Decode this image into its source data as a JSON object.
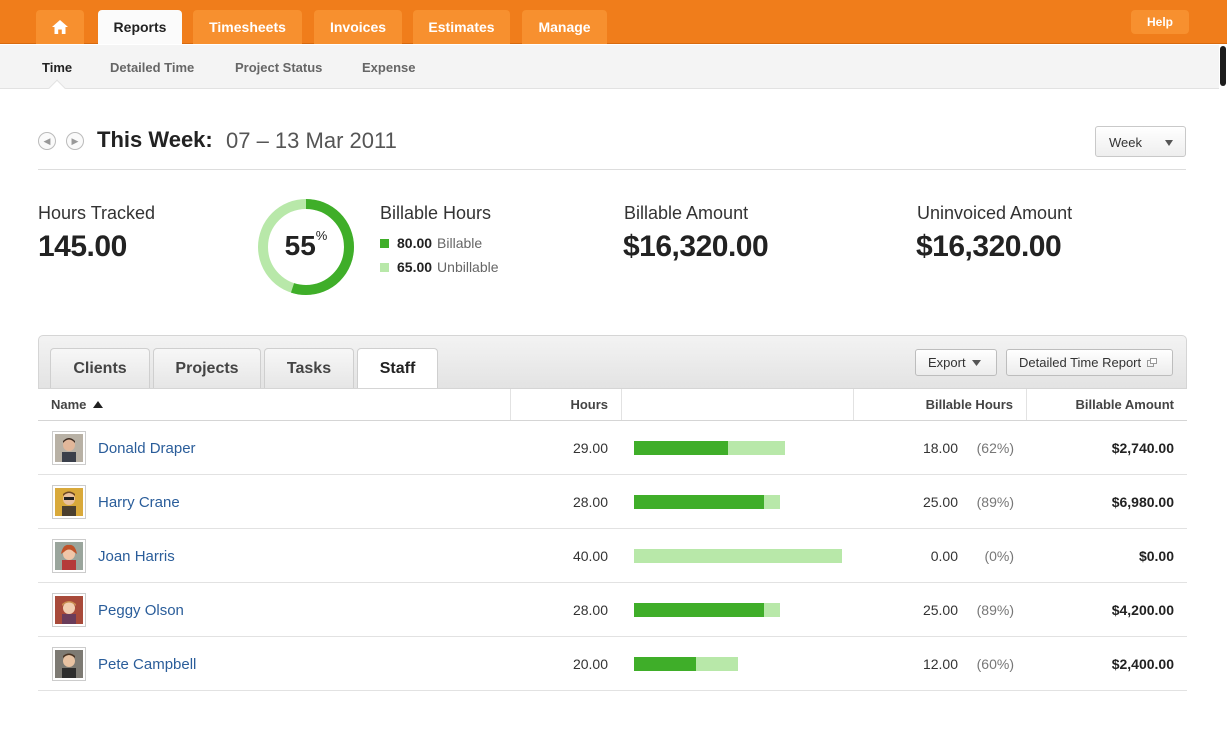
{
  "nav": {
    "tabs": [
      "Reports",
      "Timesheets",
      "Invoices",
      "Estimates",
      "Manage"
    ],
    "help": "Help"
  },
  "subnav": [
    "Time",
    "Detailed Time",
    "Project Status",
    "Expense"
  ],
  "period": {
    "label": "This Week:",
    "range": "07 – 13 Mar 2011",
    "select": "Week"
  },
  "stats": {
    "hours_tracked_label": "Hours Tracked",
    "hours_tracked": "145.00",
    "donut_pct": "55",
    "donut_pct_sign": "%",
    "billable_fraction": 0.55,
    "billable_hours_label": "Billable Hours",
    "billable_value": "80.00",
    "billable_text": "Billable",
    "unbillable_value": "65.00",
    "unbillable_text": "Unbillable",
    "billable_amount_label": "Billable Amount",
    "billable_amount": "$16,320.00",
    "uninvoiced_label": "Uninvoiced Amount",
    "uninvoiced_amount": "$16,320.00"
  },
  "table": {
    "tabs": [
      "Clients",
      "Projects",
      "Tasks",
      "Staff"
    ],
    "export": "Export",
    "detailed_report": "Detailed Time Report",
    "headers": {
      "name": "Name",
      "hours": "Hours",
      "billable_hours": "Billable Hours",
      "billable_amount": "Billable Amount"
    },
    "rows": [
      {
        "name": "Donald Draper",
        "hours": "29.00",
        "billable": "18.00",
        "pct": "(62%)",
        "amount": "$2,740.00",
        "hours_val": 29,
        "billable_val": 18
      },
      {
        "name": "Harry Crane",
        "hours": "28.00",
        "billable": "25.00",
        "pct": "(89%)",
        "amount": "$6,980.00",
        "hours_val": 28,
        "billable_val": 25
      },
      {
        "name": "Joan Harris",
        "hours": "40.00",
        "billable": "0.00",
        "pct": "(0%)",
        "amount": "$0.00",
        "hours_val": 40,
        "billable_val": 0
      },
      {
        "name": "Peggy Olson",
        "hours": "28.00",
        "billable": "25.00",
        "pct": "(89%)",
        "amount": "$4,200.00",
        "hours_val": 28,
        "billable_val": 25
      },
      {
        "name": "Pete Campbell",
        "hours": "20.00",
        "billable": "12.00",
        "pct": "(60%)",
        "amount": "$2,400.00",
        "hours_val": 20,
        "billable_val": 12
      }
    ]
  },
  "colors": {
    "brand": "#f07d1b",
    "billable": "#3fae29",
    "unbillable": "#b8e8a9",
    "link": "#2a5d9a"
  },
  "icons": {
    "home": "home-icon",
    "prev": "prev-arrow-icon",
    "next": "next-arrow-icon",
    "sort": "sort-ascending-icon",
    "external": "external-window-icon"
  }
}
